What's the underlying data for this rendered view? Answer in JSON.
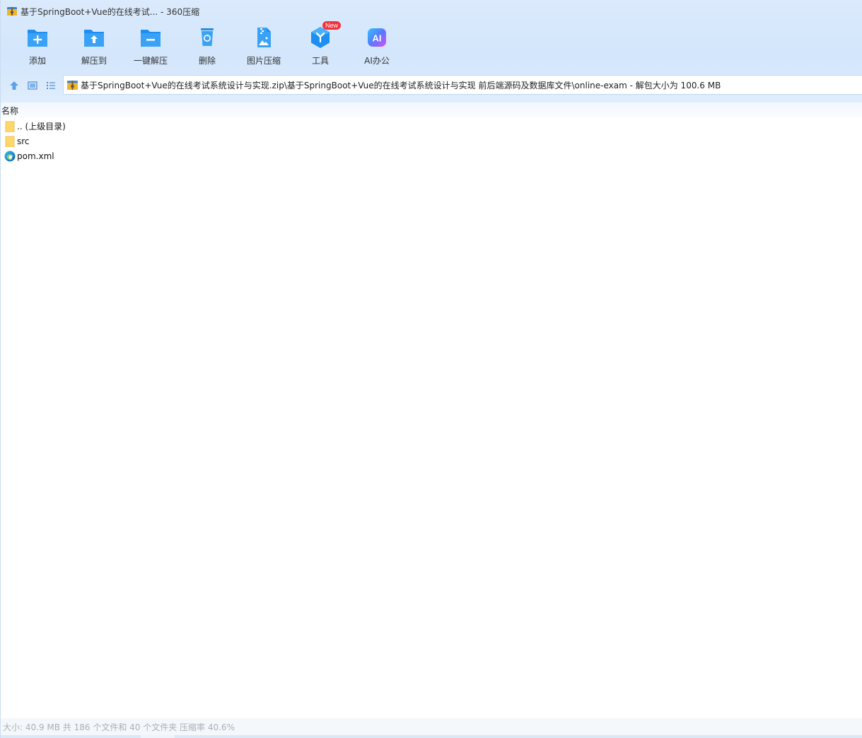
{
  "window": {
    "title": "基于SpringBoot+Vue的在线考试... - 360压缩"
  },
  "toolbar": {
    "items": [
      {
        "label": "添加",
        "icon": "folder-add-icon"
      },
      {
        "label": "解压到",
        "icon": "folder-extract-icon"
      },
      {
        "label": "一键解压",
        "icon": "one-click-extract-icon"
      },
      {
        "label": "删除",
        "icon": "recycle-bin-icon"
      },
      {
        "label": "图片压缩",
        "icon": "image-compress-icon"
      },
      {
        "label": "工具",
        "icon": "tools-cube-icon",
        "badge": "New"
      },
      {
        "label": "AI办公",
        "icon": "ai-office-icon",
        "icon_text": "AI"
      }
    ]
  },
  "nav": {
    "up": "up-arrow-icon",
    "thumbnail_view": "thumbnail-view-icon",
    "list_view": "list-view-icon"
  },
  "address": {
    "path": "基于SpringBoot+Vue的在线考试系统设计与实现.zip\\基于SpringBoot+Vue的在线考试系统设计与实现 前后端源码及数据库文件\\online-exam - 解包大小为 100.6 MB"
  },
  "list": {
    "column_name": "名称",
    "rows": [
      {
        "name": ".. (上级目录)",
        "icon": "folder-icon"
      },
      {
        "name": "src",
        "icon": "folder-icon"
      },
      {
        "name": "pom.xml",
        "icon": "edge-browser-icon"
      }
    ]
  },
  "status": {
    "text": "大小: 40.9 MB 共 186 个文件和 40 个文件夹 压缩率 40.6%"
  },
  "colors": {
    "accent": "#1e8ff0",
    "header_bg": "#d8e8fb",
    "folder": "#ffd76b",
    "badge": "#f2323b"
  }
}
